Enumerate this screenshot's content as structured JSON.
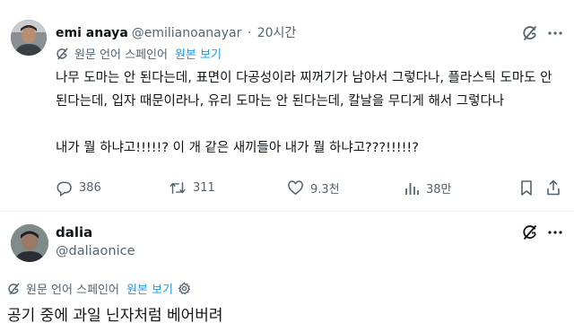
{
  "tweet1": {
    "display_name": "emi anaya",
    "handle": "@emilianoanayar",
    "separator": "·",
    "time": "20시간",
    "translation": {
      "label": "원문 언어 스페인어",
      "view_original": "원본 보기"
    },
    "paragraphs": [
      "나무 도마는 안 된다는데, 표면이 다공성이라 찌꺼기가 남아서 그렇다나, 플라스틱 도마도 안 된다는데, 입자 때문이라나, 유리 도마는 안 된다는데, 칼날을 무디게 해서 그렇다나",
      "내가 뭘 하냐고!!!!!? 이 개 같은 새끼들아 내가 뭘 하냐고???!!!!!?"
    ],
    "actions": {
      "replies": "386",
      "retweets": "311",
      "likes": "9.3천",
      "views": "38만"
    }
  },
  "tweet2": {
    "display_name": "dalia",
    "handle": "@daliaonice",
    "translation": {
      "label": "원문 언어 스페인어",
      "view_original": "원본 보기"
    },
    "text": "공기 중에 과일 닌자처럼 베어버려"
  },
  "colors": {
    "text": "#0f1419",
    "secondary": "#536471",
    "link": "#1d9bf0",
    "divider": "#eff3f4"
  },
  "icons": [
    "grok-icon",
    "more-icon",
    "translate-icon",
    "reply-icon",
    "retweet-icon",
    "like-icon",
    "views-icon",
    "bookmark-icon",
    "share-icon",
    "settings-icon"
  ]
}
